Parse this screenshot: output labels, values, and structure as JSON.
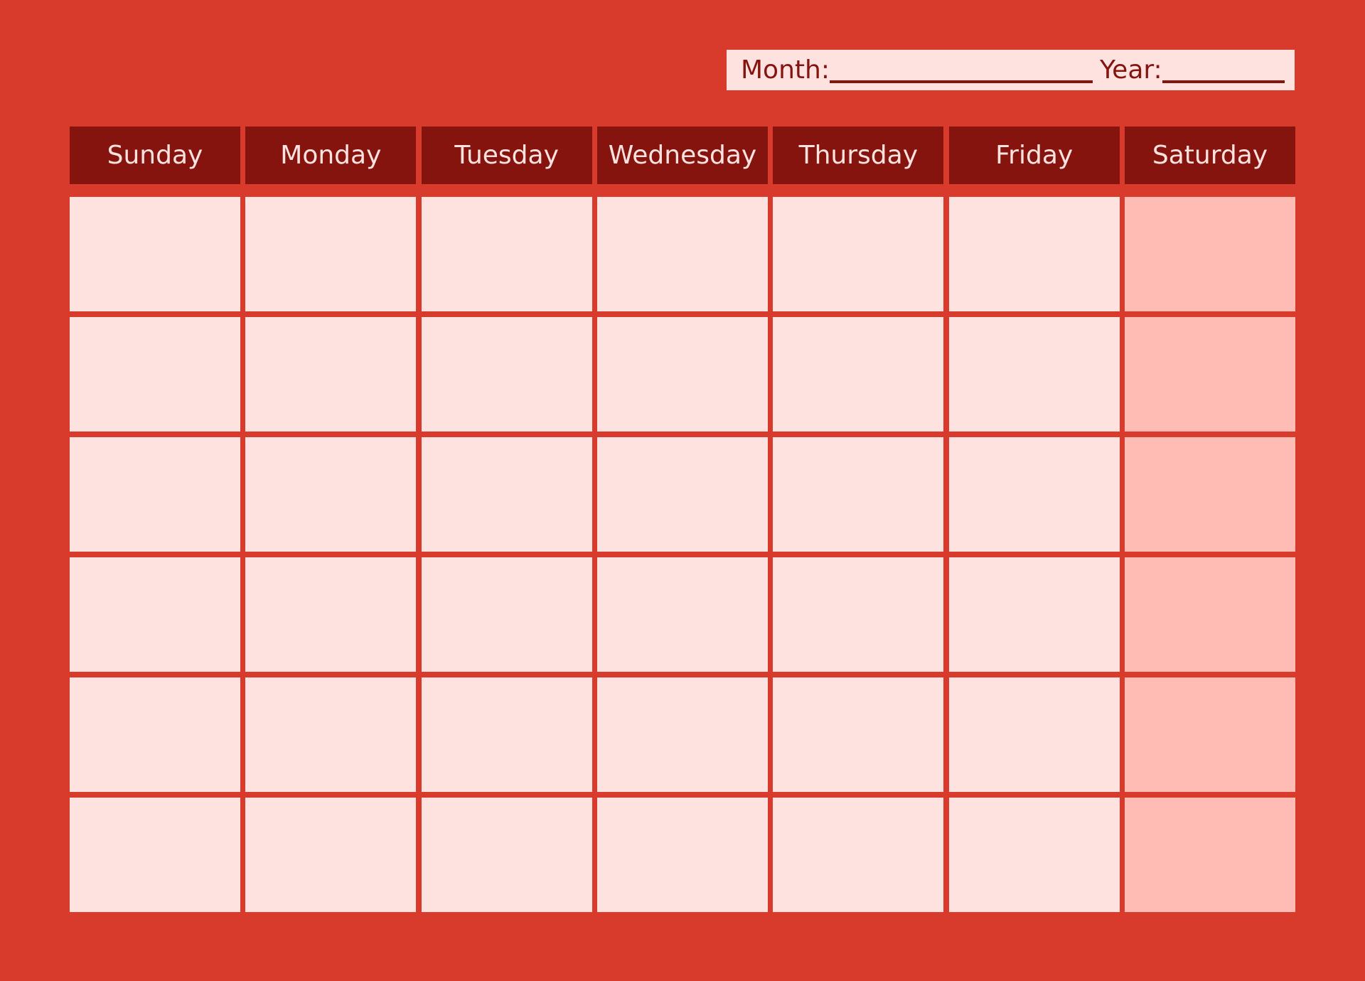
{
  "header": {
    "month_label": "Month:",
    "year_label": "Year:"
  },
  "weekdays": [
    "Sunday",
    "Monday",
    "Tuesday",
    "Wednesday",
    "Thursday",
    "Friday",
    "Saturday"
  ],
  "weeks": 6,
  "colors": {
    "background": "#d83a2c",
    "header_bg": "#85140f",
    "header_text": "#fee2df",
    "cell": "#fee2df",
    "weekend_cell": "#ffbcb4"
  }
}
